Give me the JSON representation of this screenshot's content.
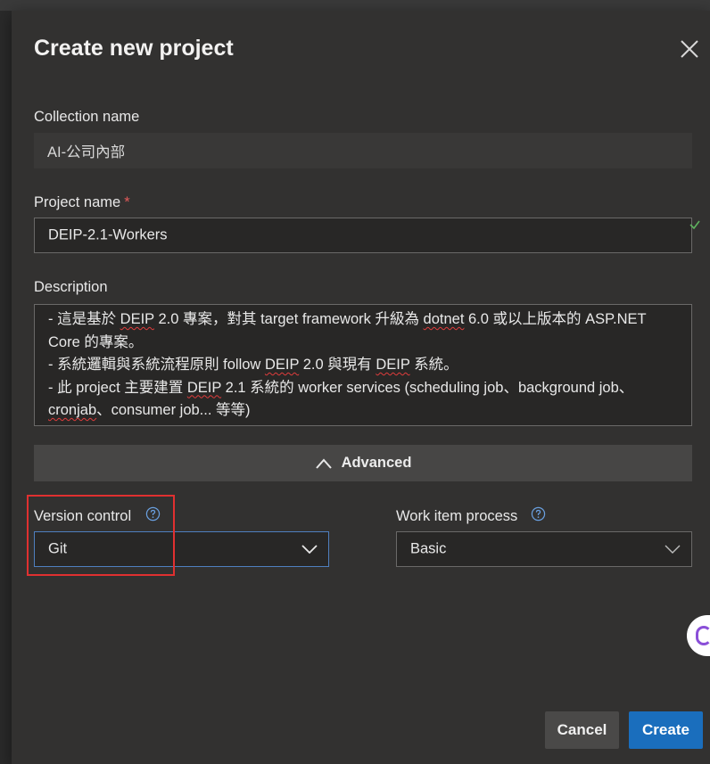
{
  "dialog": {
    "title": "Create new project",
    "close_icon": "close-icon"
  },
  "collection": {
    "label": "Collection name",
    "value": "AI-公司內部"
  },
  "project_name": {
    "label": "Project name",
    "required_mark": "*",
    "value": "DEIP-2.1-Workers"
  },
  "description": {
    "label": "Description",
    "lines": [
      [
        {
          "t": "- 這是基於 ",
          "s": false
        },
        {
          "t": "DEIP",
          "s": true
        },
        {
          "t": " 2.0 專案，對其 target framework 升級為 ",
          "s": false
        },
        {
          "t": "dotnet",
          "s": true
        },
        {
          "t": " 6.0 或以上版本的 ASP.NET",
          "s": false
        }
      ],
      [
        {
          "t": "Core 的專案。",
          "s": false
        }
      ],
      [
        {
          "t": "- 系統邏輯與系統流程原則 follow ",
          "s": false
        },
        {
          "t": "DEIP",
          "s": true
        },
        {
          "t": " 2.0 與現有 ",
          "s": false
        },
        {
          "t": "DEIP",
          "s": true
        },
        {
          "t": " 系統。",
          "s": false
        }
      ],
      [
        {
          "t": "- 此 project 主要建置 ",
          "s": false
        },
        {
          "t": "DEIP",
          "s": true
        },
        {
          "t": " 2.1 系統的 worker services (scheduling job、background job、",
          "s": false
        }
      ],
      [
        {
          "t": "cronjab",
          "s": true
        },
        {
          "t": "、consumer job... 等等)",
          "s": false
        }
      ]
    ]
  },
  "advanced": {
    "label": "Advanced",
    "icon": "chevron-up-icon"
  },
  "version_control": {
    "label": "Version control",
    "help_icon": "help-icon",
    "value": "Git"
  },
  "work_item_process": {
    "label": "Work item process",
    "help_icon": "help-icon",
    "value": "Basic"
  },
  "actions": {
    "cancel_label": "Cancel",
    "create_label": "Create"
  },
  "colors": {
    "accent": "#1a6ebd",
    "highlight": "#e03030",
    "required": "#e05a5a"
  }
}
